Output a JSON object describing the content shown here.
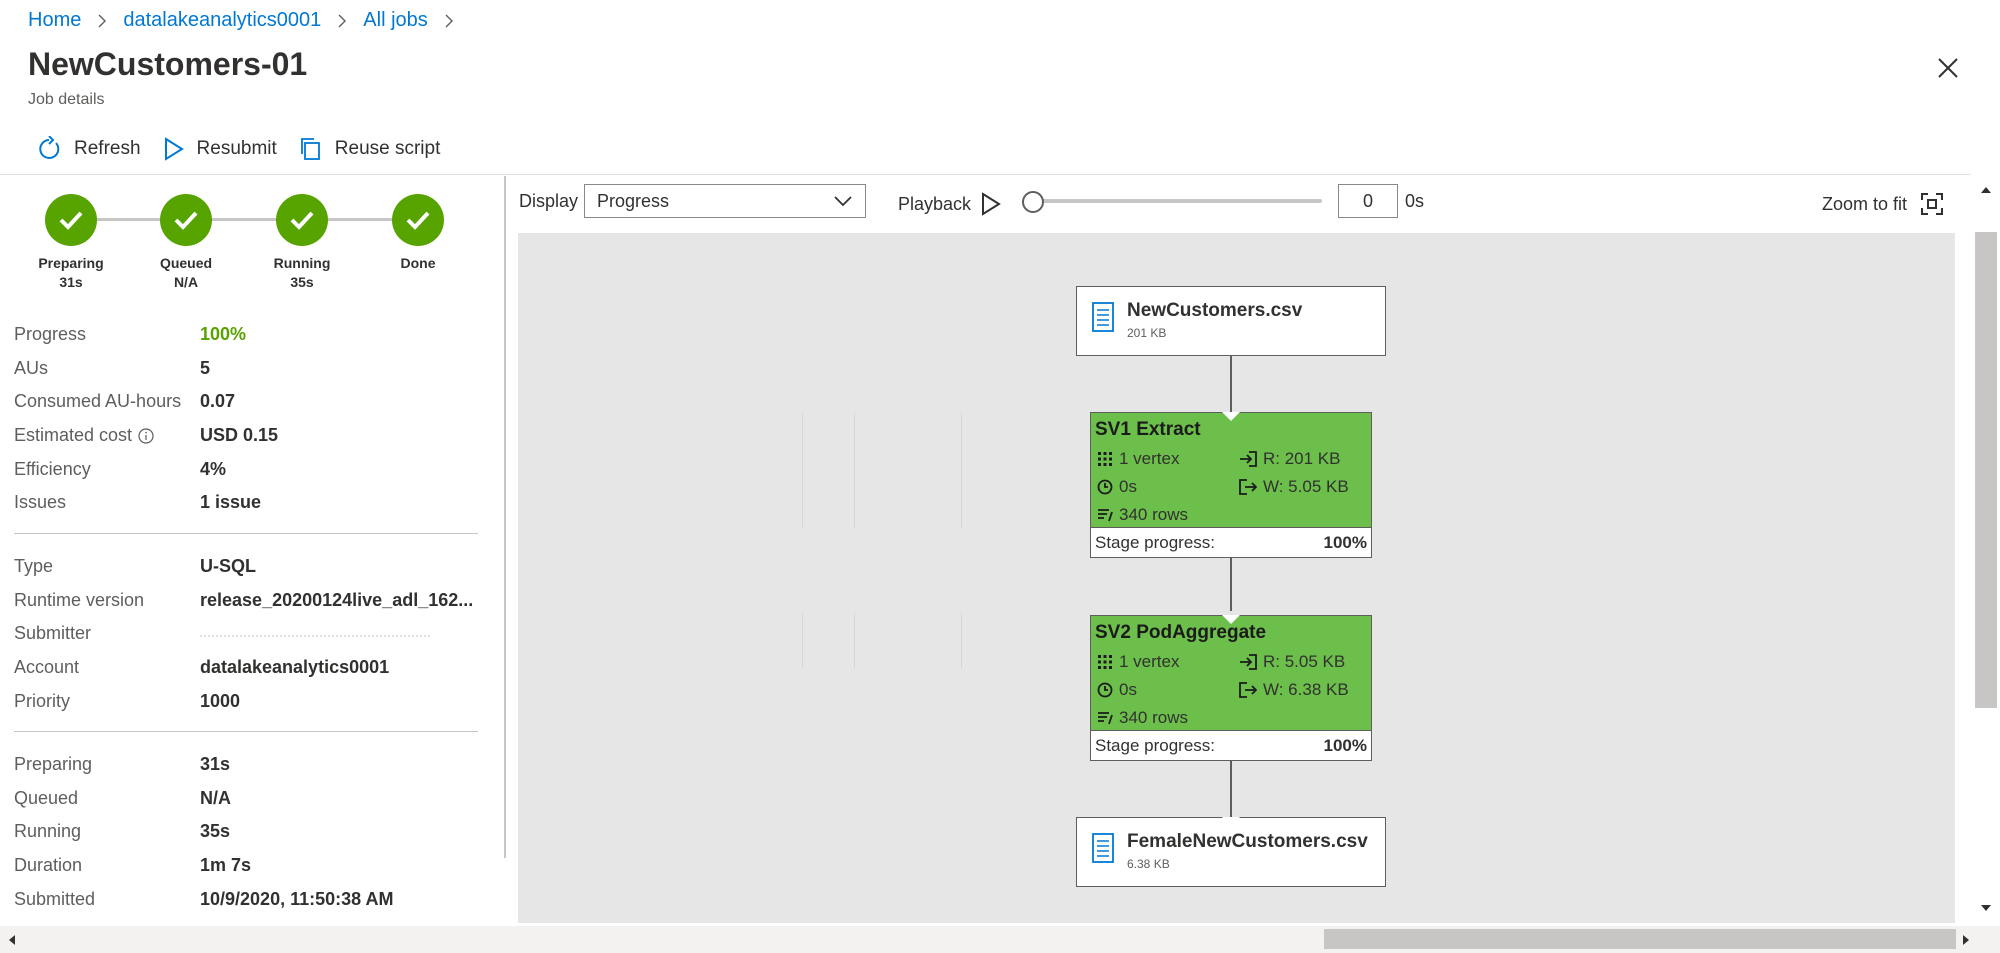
{
  "breadcrumb": {
    "items": [
      "Home",
      "datalakeanalytics0001",
      "All jobs"
    ]
  },
  "header": {
    "title": "NewCustomers-01",
    "subtitle": "Job details"
  },
  "toolbar": {
    "refresh_label": "Refresh",
    "resubmit_label": "Resubmit",
    "reuse_label": "Reuse script"
  },
  "steps": [
    {
      "name": "Preparing",
      "time": "31s",
      "state": "done"
    },
    {
      "name": "Queued",
      "time": "N/A",
      "state": "done"
    },
    {
      "name": "Running",
      "time": "35s",
      "state": "done"
    },
    {
      "name": "Done",
      "time": "",
      "state": "done"
    }
  ],
  "summary": [
    {
      "label": "Progress",
      "value": "100%"
    },
    {
      "label": "AUs",
      "value": "5"
    },
    {
      "label": "Consumed AU-hours",
      "value": "0.07"
    },
    {
      "label": "Estimated cost",
      "value": "USD 0.15"
    },
    {
      "label": "Efficiency",
      "value": "4%"
    },
    {
      "label": "Issues",
      "value": "1 issue"
    }
  ],
  "details": [
    {
      "label": "Type",
      "value": "U-SQL"
    },
    {
      "label": "Runtime version",
      "value": "release_20200124live_adl_162..."
    },
    {
      "label": "Submitter",
      "value": ""
    },
    {
      "label": "Account",
      "value": "datalakeanalytics0001"
    },
    {
      "label": "Priority",
      "value": "1000"
    }
  ],
  "timing": [
    {
      "label": "Preparing",
      "value": "31s"
    },
    {
      "label": "Queued",
      "value": "N/A"
    },
    {
      "label": "Running",
      "value": "35s"
    },
    {
      "label": "Duration",
      "value": "1m 7s"
    },
    {
      "label": "Submitted",
      "value": "10/9/2020, 11:50:38 AM"
    }
  ],
  "graph_controls": {
    "display_label": "Display",
    "display_value": "Progress",
    "playback_label": "Playback",
    "playback_position": 0,
    "time_value": "0",
    "time_unit": "0s",
    "zoom_label": "Zoom to fit"
  },
  "graph": {
    "input_file": {
      "name": "NewCustomers.csv",
      "size": "201 KB"
    },
    "stages": [
      {
        "title": "SV1 Extract",
        "vertices": "1 vertex",
        "time": "0s",
        "rows": "340 rows",
        "read": "R: 201 KB",
        "write": "W: 5.05 KB",
        "progress_label": "Stage progress:",
        "progress": "100%"
      },
      {
        "title": "SV2 PodAggregate",
        "vertices": "1 vertex",
        "time": "0s",
        "rows": "340 rows",
        "read": "R: 5.05 KB",
        "write": "W: 6.38 KB",
        "progress_label": "Stage progress:",
        "progress": "100%"
      }
    ],
    "output_file": {
      "name": "FemaleNewCustomers.csv",
      "size": "6.38 KB"
    }
  },
  "colors": {
    "accent": "#0078d4",
    "success": "#57a300",
    "stage_fill": "#6bbf4a",
    "canvas_bg": "#e6e6e6"
  }
}
